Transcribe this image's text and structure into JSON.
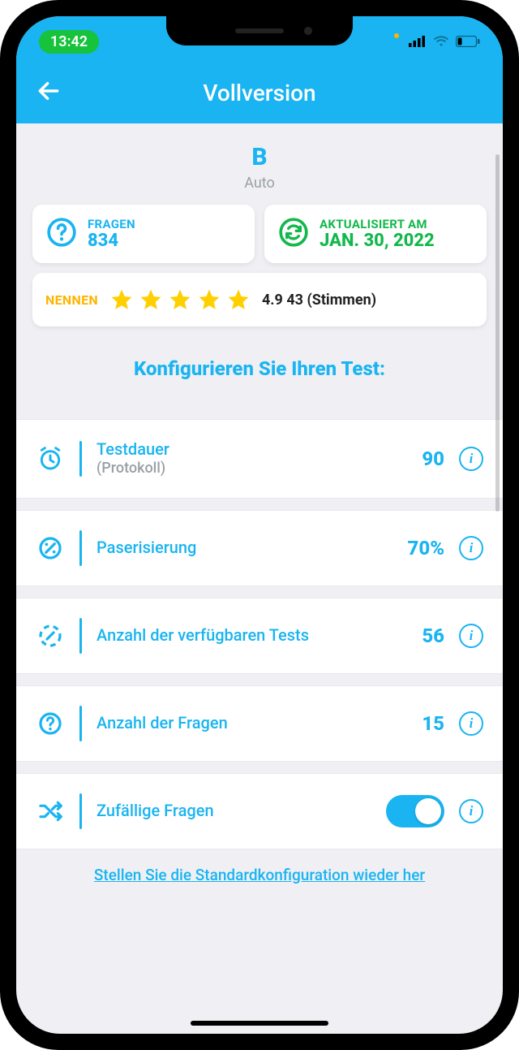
{
  "status": {
    "time": "13:42"
  },
  "header": {
    "title": "Vollversion"
  },
  "category": {
    "letter": "B",
    "sub": "Auto"
  },
  "questions_card": {
    "label": "FRAGEN",
    "value": "834"
  },
  "updated_card": {
    "label": "AKTUALISIERT AM",
    "value": "JAN. 30, 2022"
  },
  "rating": {
    "label": "NENNEN",
    "score": "4.9",
    "votes": "43",
    "votes_word": "(Stimmen)"
  },
  "config_title": "Konfigurieren Sie Ihren Test:",
  "rows": {
    "duration": {
      "label": "Testdauer",
      "sub": "(Protokoll)",
      "value": "90"
    },
    "passing": {
      "label": "Paserisierung",
      "value": "70%"
    },
    "tests": {
      "label": "Anzahl der verfügbaren Tests",
      "value": "56"
    },
    "qcount": {
      "label": "Anzahl der Fragen",
      "value": "15"
    },
    "random": {
      "label": "Zufällige Fragen",
      "on": true
    }
  },
  "restore_link": "Stellen Sie die Standardkonfiguration wieder her"
}
